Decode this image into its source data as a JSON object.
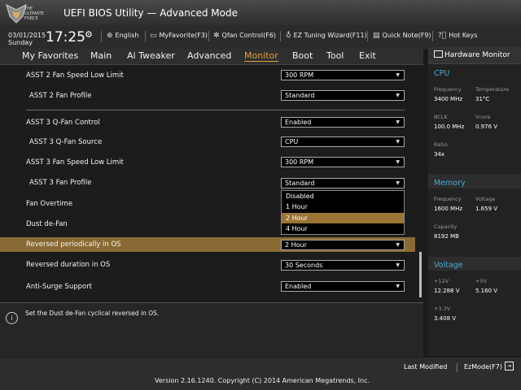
{
  "header": {
    "logo_text": [
      "THE",
      "ULTIMATE",
      "FORCE"
    ],
    "title": "UEFI BIOS Utility — Advanced Mode"
  },
  "infobar": {
    "date": "03/01/2015",
    "day": "Sunday",
    "time": "17:25",
    "items": [
      {
        "icon": "globe-icon",
        "label": "English"
      },
      {
        "icon": "monitor-icon",
        "label": "MyFavorite(F3)"
      },
      {
        "icon": "fan-icon",
        "label": "Qfan Control(F6)"
      },
      {
        "icon": "bulb-icon",
        "label": "EZ Tuning Wizard(F11)"
      },
      {
        "icon": "note-icon",
        "label": "Quick Note(F9)"
      },
      {
        "icon": "question-icon",
        "label": "Hot Keys"
      }
    ]
  },
  "tabs": [
    "My Favorites",
    "Main",
    "Ai Tweaker",
    "Advanced",
    "Monitor",
    "Boot",
    "Tool",
    "Exit"
  ],
  "active_tab": "Monitor",
  "settings": [
    {
      "label": "ASST 2 Fan Speed Low Limit",
      "value": "300 RPM"
    },
    {
      "label": "ASST 2 Fan Profile",
      "value": "Standard"
    },
    {
      "label": "ASST 3 Q-Fan Control",
      "value": "Enabled"
    },
    {
      "label": "ASST 3 Q-Fan Source",
      "value": "CPU"
    },
    {
      "label": "ASST 3 Fan Speed Low Limit",
      "value": "300 RPM"
    },
    {
      "label": "ASST 3 Fan Profile",
      "value": "Standard"
    },
    {
      "label": "Fan Overtime",
      "value": ""
    },
    {
      "label": "Dust de-Fan",
      "value": ""
    },
    {
      "label": "Reversed periodically in OS",
      "value": "2 Hour"
    },
    {
      "label": "Reversed duration in OS",
      "value": "30 Seconds"
    },
    {
      "label": "Anti-Surge Support",
      "value": "Enabled"
    }
  ],
  "dropdown": {
    "options": [
      "Disabled",
      "1 Hour",
      "2 Hour",
      "4 Hour"
    ],
    "selected": "2 Hour"
  },
  "help_text": "Set the Dust de-Fan cyclical reversed in OS.",
  "hardware_monitor": {
    "title": "Hardware Monitor",
    "cpu": {
      "heading": "CPU",
      "frequency_label": "Frequency",
      "frequency": "3400 MHz",
      "temperature_label": "Temperature",
      "temperature": "31°C",
      "bclk_label": "BCLK",
      "bclk": "100.0 MHz",
      "vcore_label": "Vcore",
      "vcore": "0.976 V",
      "ratio_label": "Ratio",
      "ratio": "34x"
    },
    "memory": {
      "heading": "Memory",
      "frequency_label": "Frequency",
      "frequency": "1600 MHz",
      "voltage_label": "Voltage",
      "voltage": "1.659 V",
      "capacity_label": "Capacity",
      "capacity": "8192 MB"
    },
    "voltage": {
      "heading": "Voltage",
      "v12_label": "+12V",
      "v12": "12.288 V",
      "v5_label": "+5V",
      "v5": "5.160 V",
      "v33_label": "+3.3V",
      "v33": "3.408 V"
    }
  },
  "footer": {
    "last_modified": "Last Modified",
    "ezmode": "EzMode(F7)",
    "version": "Version 2.16.1240. Copyright (C) 2014 American Megatrends, Inc."
  },
  "colors": {
    "accent": "#e0a23a",
    "highlight_row": "#8a6a34",
    "section_blue": "#4aa8d8"
  }
}
